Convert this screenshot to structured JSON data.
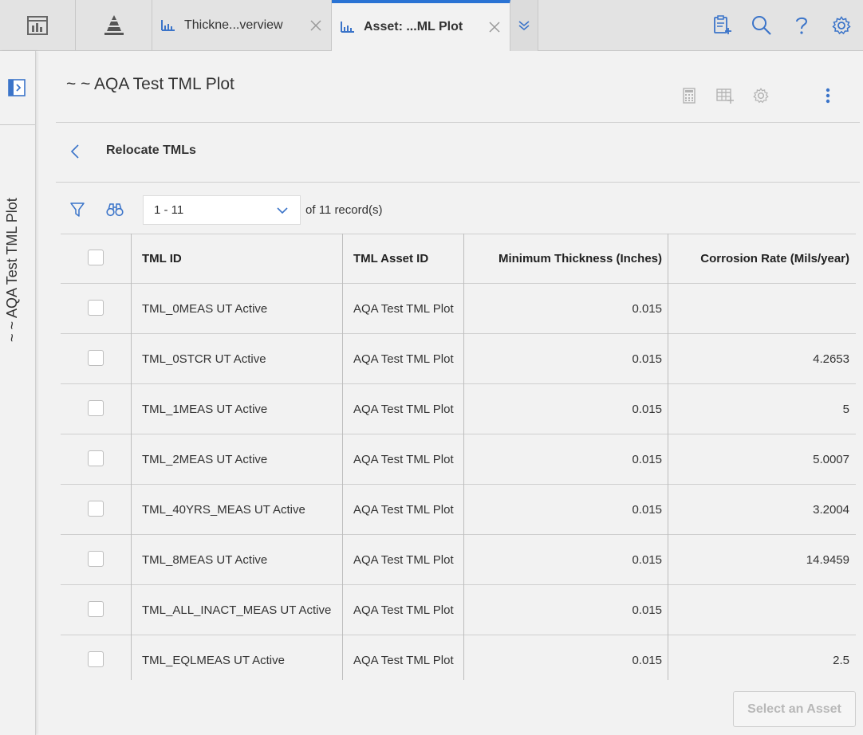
{
  "tabs": [
    {
      "label": "Thickne...verview",
      "icon": "chart-icon"
    },
    {
      "label": "Asset: ...ML Plot",
      "icon": "chart-icon",
      "active": true
    }
  ],
  "header": {
    "page_title": "~ ~ AQA Test TML Plot",
    "rail_title": "~ ~ AQA Test TML Plot"
  },
  "section": {
    "title": "Relocate TMLs"
  },
  "pager": {
    "range": "1 - 11",
    "of_label": "of",
    "total": "11",
    "records_label": "record(s)"
  },
  "table": {
    "columns": [
      "TML ID",
      "TML Asset ID",
      "Minimum Thickness (Inches)",
      "Corrosion Rate (Mils/year)"
    ],
    "rows": [
      {
        "id": "TML_0MEAS UT Active",
        "asset": "AQA Test TML Plot",
        "min": "0.015",
        "rate": ""
      },
      {
        "id": "TML_0STCR UT Active",
        "asset": "AQA Test TML Plot",
        "min": "0.015",
        "rate": "4.2653"
      },
      {
        "id": "TML_1MEAS UT Active",
        "asset": "AQA Test TML Plot",
        "min": "0.015",
        "rate": "5"
      },
      {
        "id": "TML_2MEAS UT Active",
        "asset": "AQA Test TML Plot",
        "min": "0.015",
        "rate": "5.0007"
      },
      {
        "id": "TML_40YRS_MEAS UT Active",
        "asset": "AQA Test TML Plot",
        "min": "0.015",
        "rate": "3.2004"
      },
      {
        "id": "TML_8MEAS UT Active",
        "asset": "AQA Test TML Plot",
        "min": "0.015",
        "rate": "14.9459"
      },
      {
        "id": "TML_ALL_INACT_MEAS UT Active",
        "asset": "AQA Test TML Plot",
        "min": "0.015",
        "rate": ""
      },
      {
        "id": "TML_EQLMEAS UT Active",
        "asset": "AQA Test TML Plot",
        "min": "0.015",
        "rate": "2.5"
      }
    ]
  },
  "footer": {
    "select_label": "Select an Asset"
  },
  "colors": {
    "accent": "#2a73d4",
    "icon_blue": "#3b74c9",
    "icon_grey": "#b3b3b3"
  }
}
